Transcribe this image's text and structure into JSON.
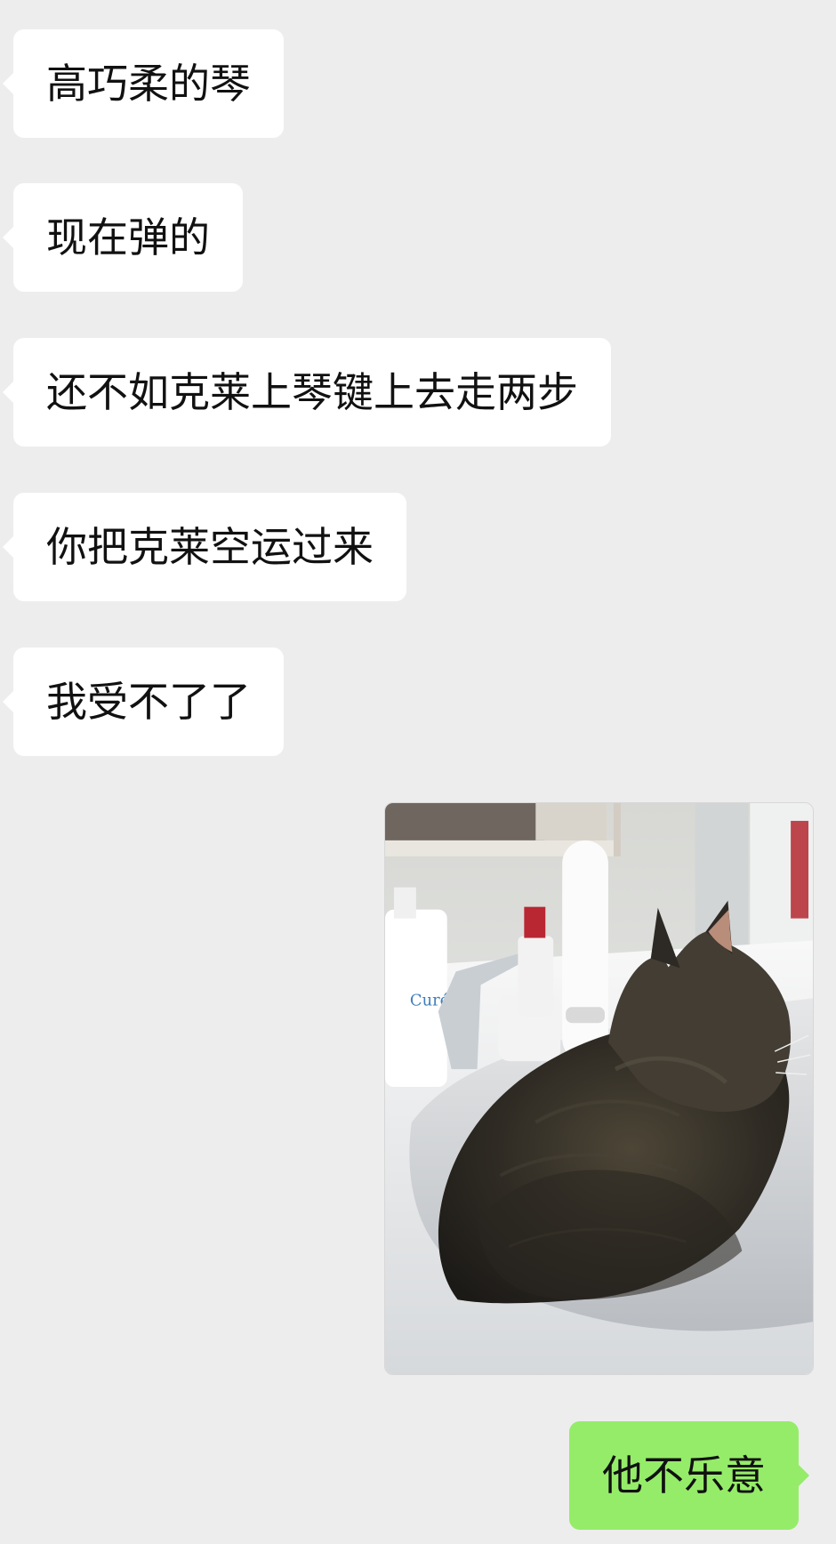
{
  "chat": {
    "incoming_messages": [
      "高巧柔的琴",
      "现在弹的",
      "还不如克莱上琴键上去走两步",
      "你把克莱空运过来",
      "我受不了了"
    ],
    "outgoing_image": {
      "kind": "photo",
      "subject": "cat-in-sink",
      "visible_brand_text": "Curél"
    },
    "outgoing_messages": [
      "他不乐意"
    ]
  },
  "colors": {
    "background": "#ededed",
    "incoming_bubble": "#ffffff",
    "outgoing_bubble": "#95ec69",
    "text": "#111111"
  }
}
